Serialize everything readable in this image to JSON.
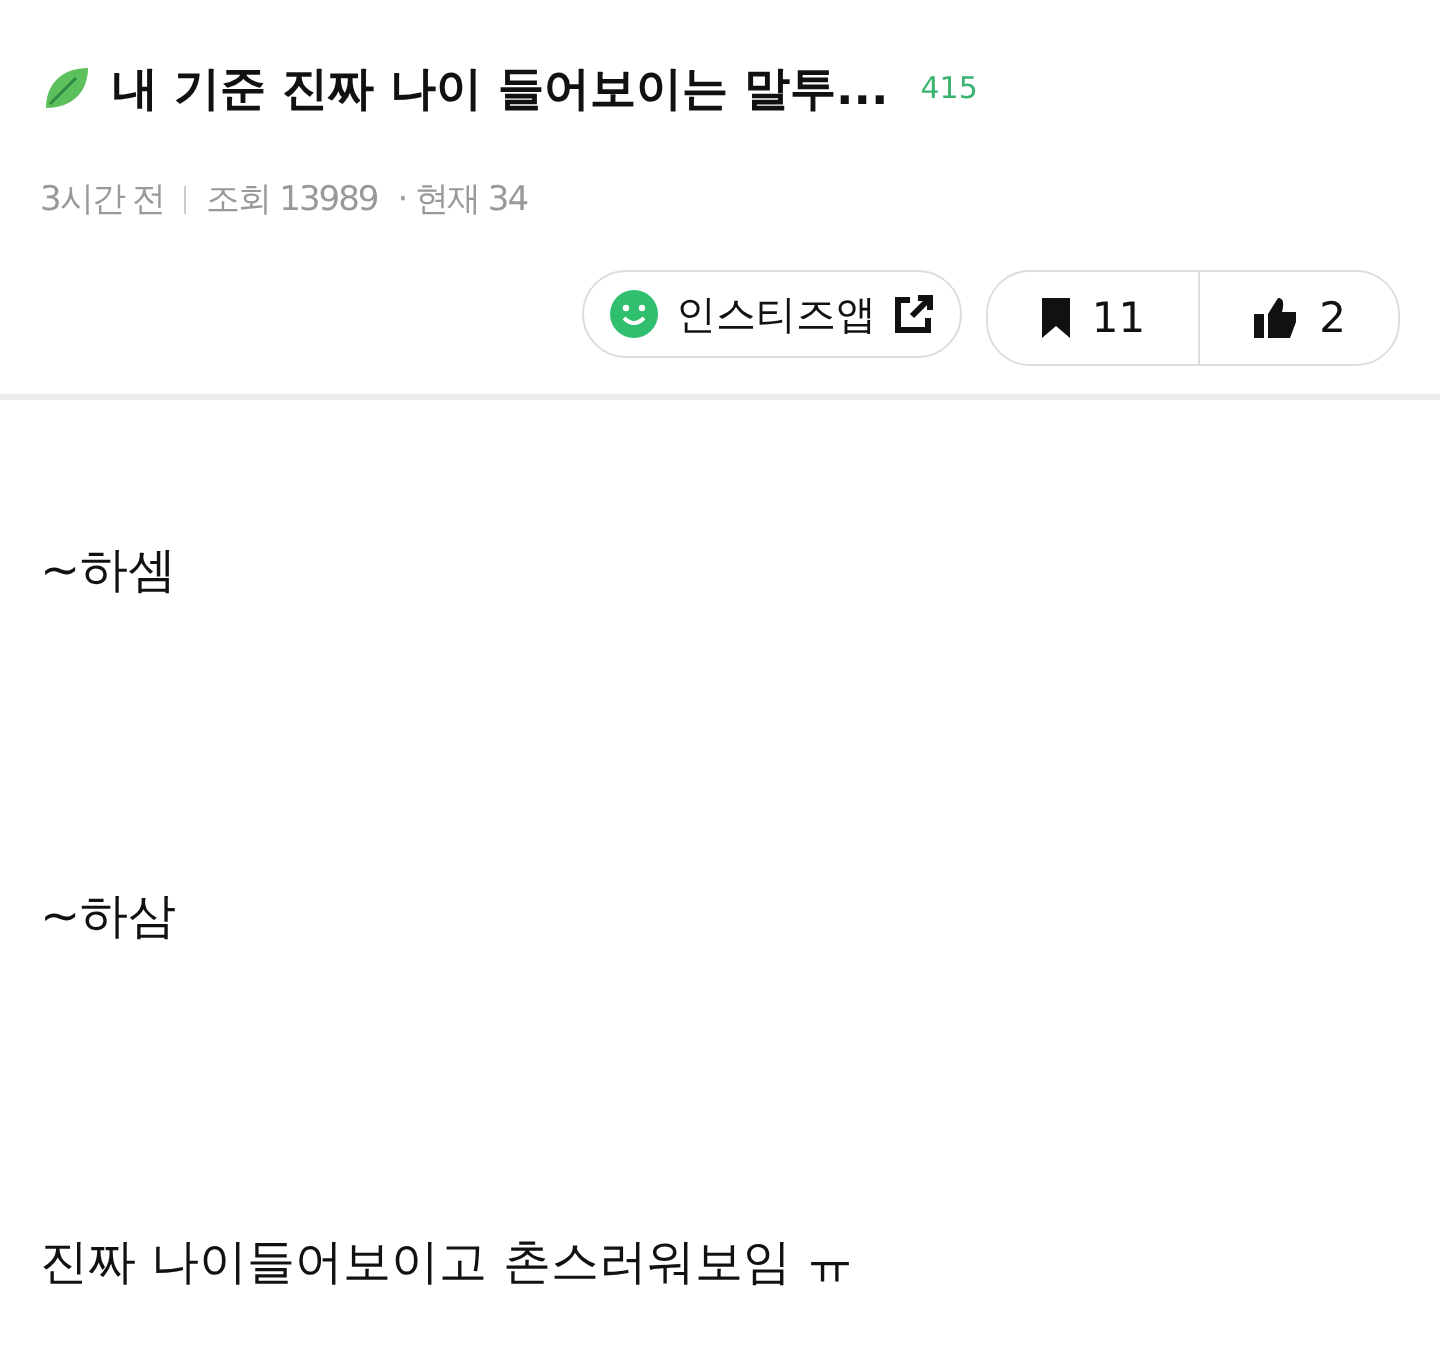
{
  "post": {
    "title": "내 기준 진짜 나이 들어보이는 말투...",
    "comment_count": "415",
    "time": "3시간 전",
    "views": "조회 13989",
    "current": "· 현재 34",
    "app_link": "인스티즈앱",
    "bookmarks": "11",
    "likes": "2"
  },
  "body": [
    "~하셈",
    "~하삼",
    "진짜 나이들어보이고 촌스러워보임 ㅠ"
  ]
}
